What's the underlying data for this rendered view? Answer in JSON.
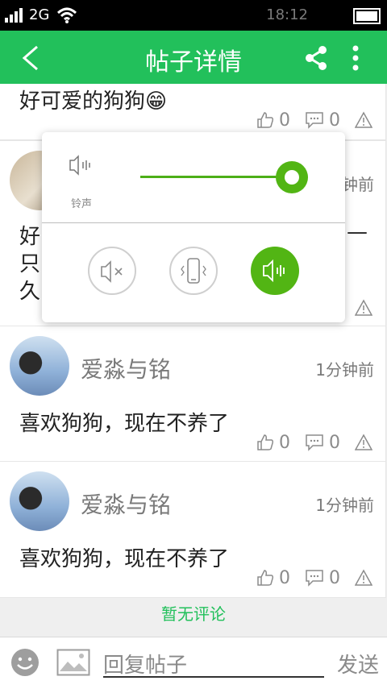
{
  "status": {
    "network": "2G",
    "time": "18:12"
  },
  "header": {
    "title": "帖子详情",
    "icons": [
      "back-icon",
      "share-icon",
      "more-vert-icon"
    ]
  },
  "posts": [
    {
      "text": "好可爱的狗狗😁",
      "likes": "0",
      "comments": "0"
    },
    {
      "time_partial": "钟前",
      "text_partial_1": "好",
      "text_partial_2": "只",
      "text_partial_3": "久",
      "trailing": "—"
    },
    {
      "name": "爱淼与铭",
      "time": "1分钟前",
      "text": "喜欢狗狗，现在不养了",
      "likes": "0",
      "comments": "0"
    },
    {
      "name": "爱淼与铭",
      "time": "1分钟前",
      "text": "喜欢狗狗，现在不养了",
      "likes": "0",
      "comments": "0"
    }
  ],
  "no_comments": "暂无评论",
  "footer": {
    "reply_placeholder": "回复帖子",
    "send_label": "发送",
    "icons": [
      "emoji-icon",
      "image-icon"
    ]
  },
  "popup": {
    "label": "铃声",
    "volume_percent": 100,
    "modes": [
      "mute-icon",
      "vibrate-icon",
      "ringer-icon"
    ],
    "selected_mode": "ringer-icon",
    "accent": "#52b514"
  },
  "colors": {
    "brand": "#22c05b",
    "text": "#222222",
    "muted": "#7a7a7a"
  }
}
